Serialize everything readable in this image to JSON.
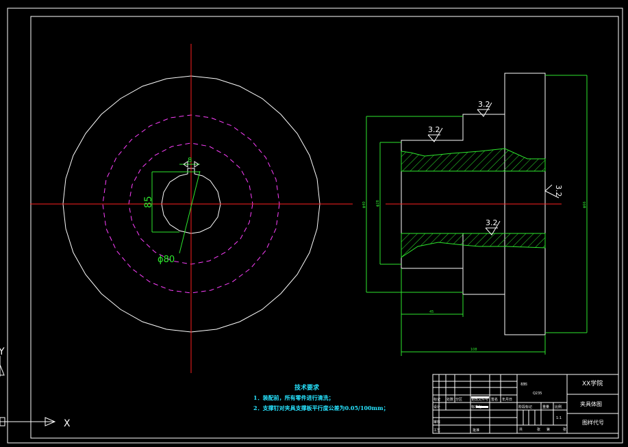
{
  "drawing": {
    "technical_requirements": {
      "title": "技术要求",
      "items": [
        "1．装配前，所有零件进行清洗；",
        "2．支撑钉对夹具支撑板平行度公差为0.05/100mm；"
      ]
    },
    "front_view": {
      "dim_key_width": "8",
      "dim_key_depth": "85",
      "dim_diameter": "ϕ80"
    },
    "section_view": {
      "roughness_top": "3.2",
      "roughness_upper": "3.2",
      "roughness_lower": "3.2",
      "roughness_right": "3.2",
      "dim_small_left": "ϕ28",
      "dim_mid_left": "ϕ40",
      "dim_right": "ϕ66",
      "dim_bottom_short": "45",
      "dim_bottom_long": "108"
    },
    "title_block": {
      "school": "XX学院",
      "drawing_name": "夹具体图",
      "drawing_code": "图样代号",
      "material_label": "材料",
      "material": "Q235",
      "scale": "1:1",
      "stage_label": "阶段标记",
      "weight_label": "重量",
      "ratio_label": "比例",
      "sheet_total": "共",
      "sheet_label": "张",
      "sheet_no": "第",
      "sheet_label2": "张",
      "mark_label": "标记",
      "count_label": "处数",
      "zone_label": "分区",
      "change_doc_label": "更改文件号",
      "sign_label": "签名",
      "date_label": "年月日",
      "design_label": "设计",
      "standard_label": "标准化",
      "check_label": "审核",
      "process_label": "工艺",
      "approve_label": "批准"
    },
    "ucs": {
      "x_axis": "X",
      "y_axis": "Y"
    }
  },
  "colors": {
    "background": "#000000",
    "outline": "#ffffff",
    "center_line": "#ff2020",
    "hidden_line": "#ff40ff",
    "dimension": "#2ee82e",
    "text_cyan": "#27e4ff"
  }
}
